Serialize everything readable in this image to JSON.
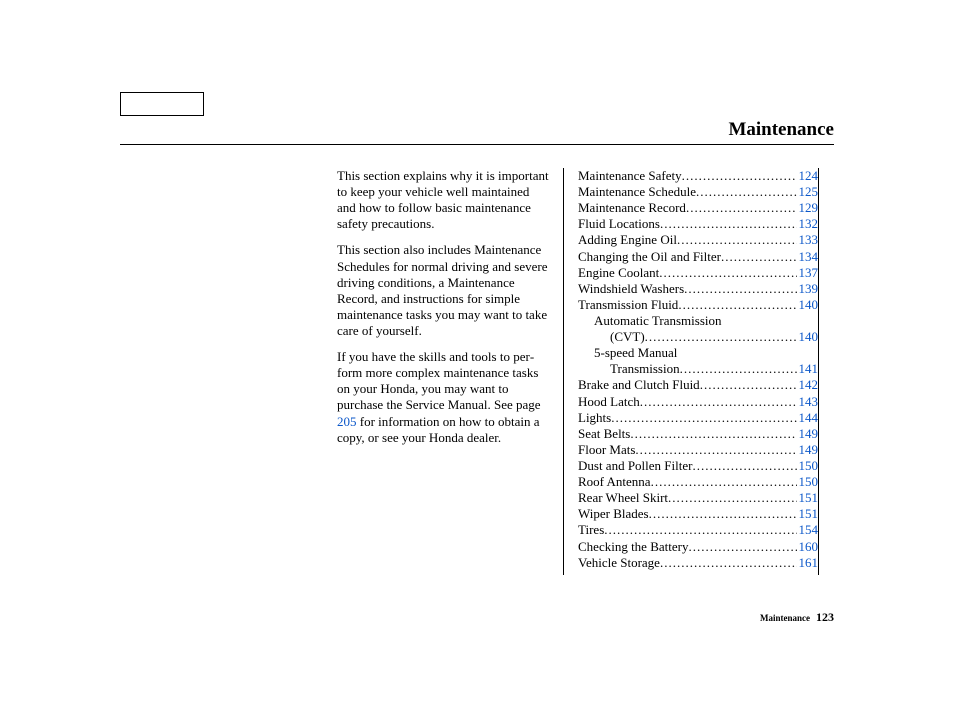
{
  "title": "Maintenance",
  "intro": {
    "p1": "This section explains why it is important to keep your vehicle well maintained and how to follow basic maintenance safety precautions.",
    "p2": "This section also includes Maintenance Schedules for normal driving and severe driving conditions, a Maintenance Record, and instruc­tions for simple maintenance tasks you may want to take care of yourself.",
    "p3_a": "If you have the skills and tools to per­form more complex maintenance tasks on your Honda, you may want to purchase the Service Manual. See page ",
    "p3_link": "205",
    "p3_b": " for information on how to obtain a copy, or see your Honda dealer."
  },
  "toc": [
    {
      "label": "Maintenance Safety",
      "page": "124",
      "indent": 0
    },
    {
      "label": "Maintenance Schedule",
      "page": "125",
      "indent": 0
    },
    {
      "label": "Maintenance Record",
      "page": "129",
      "indent": 0
    },
    {
      "label": "Fluid Locations",
      "page": "132",
      "indent": 0
    },
    {
      "label": "Adding Engine Oil",
      "page": "133",
      "indent": 0
    },
    {
      "label": "Changing the Oil and Filter",
      "page": "134",
      "indent": 0
    },
    {
      "label": "Engine Coolant",
      "page": "137",
      "indent": 0
    },
    {
      "label": "Windshield Washers",
      "page": "139",
      "indent": 0
    },
    {
      "label": "Transmission Fluid",
      "page": "140",
      "indent": 0
    },
    {
      "label_a": "Automatic Transmission",
      "label_b": "(CVT)",
      "page": "140",
      "indent": 1,
      "wrap": true
    },
    {
      "label_a": "5-speed Manual",
      "label_b": "Transmission",
      "page": "141",
      "indent": 1,
      "wrap": true
    },
    {
      "label": "Brake and Clutch Fluid",
      "page": "142",
      "indent": 0
    },
    {
      "label": "Hood Latch",
      "page": "143",
      "indent": 0
    },
    {
      "label": "Lights",
      "page": "144",
      "indent": 0
    },
    {
      "label": "Seat Belts",
      "page": "149",
      "indent": 0
    },
    {
      "label": "Floor Mats",
      "page": "149",
      "indent": 0
    },
    {
      "label": "Dust and Pollen Filter",
      "page": "150",
      "indent": 0
    },
    {
      "label": "Roof Antenna",
      "page": "150",
      "indent": 0
    },
    {
      "label": "Rear Wheel Skirt",
      "page": "151",
      "indent": 0
    },
    {
      "label": "Wiper Blades",
      "page": "151",
      "indent": 0
    },
    {
      "label": "Tires",
      "page": "154",
      "indent": 0
    },
    {
      "label": "Checking the Battery",
      "page": "160",
      "indent": 0
    },
    {
      "label": "Vehicle Storage",
      "page": "161",
      "indent": 0
    }
  ],
  "footer": {
    "section": "Maintenance",
    "page": "123"
  },
  "dots": "........................................................................"
}
